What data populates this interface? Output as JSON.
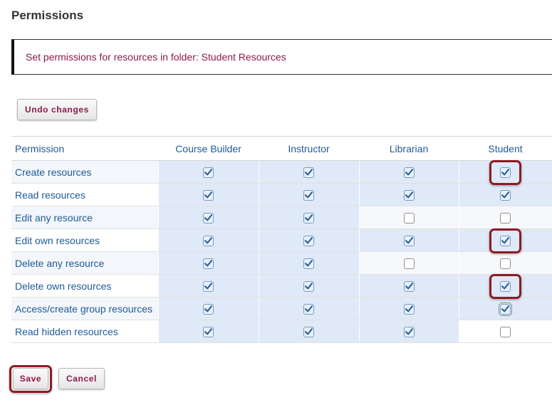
{
  "page": {
    "title": "Permissions"
  },
  "banner": {
    "text": "Set permissions for resources in folder: Student Resources"
  },
  "toolbar": {
    "undo_label": "Undo changes"
  },
  "table": {
    "headers": [
      "Permission",
      "Course Builder",
      "Instructor",
      "Librarian",
      "Student"
    ],
    "rows": [
      {
        "label": "Create resources",
        "values": [
          true,
          true,
          true,
          true
        ],
        "highlight_student": true
      },
      {
        "label": "Read resources",
        "values": [
          true,
          true,
          true,
          true
        ],
        "highlight_student": false
      },
      {
        "label": "Edit any resource",
        "values": [
          true,
          true,
          false,
          false
        ],
        "highlight_student": false
      },
      {
        "label": "Edit own resources",
        "values": [
          true,
          true,
          true,
          true
        ],
        "highlight_student": true
      },
      {
        "label": "Delete any resource",
        "values": [
          true,
          true,
          false,
          false
        ],
        "highlight_student": false
      },
      {
        "label": "Delete own resources",
        "values": [
          true,
          true,
          true,
          true
        ],
        "highlight_student": true
      },
      {
        "label": "Access/create group resources",
        "values": [
          true,
          true,
          true,
          true
        ],
        "highlight_student": false,
        "focus_student": true
      },
      {
        "label": "Read hidden resources",
        "values": [
          true,
          true,
          true,
          false
        ],
        "highlight_student": false
      }
    ]
  },
  "footer": {
    "save_label": "Save",
    "cancel_label": "Cancel"
  },
  "colors": {
    "accent": "#8b1a4a",
    "link": "#1f5b99",
    "highlight": "#8e1a22",
    "checked_cell": "#dfe9f7"
  },
  "icons": {
    "checkbox_checked": "checkmark-icon"
  }
}
